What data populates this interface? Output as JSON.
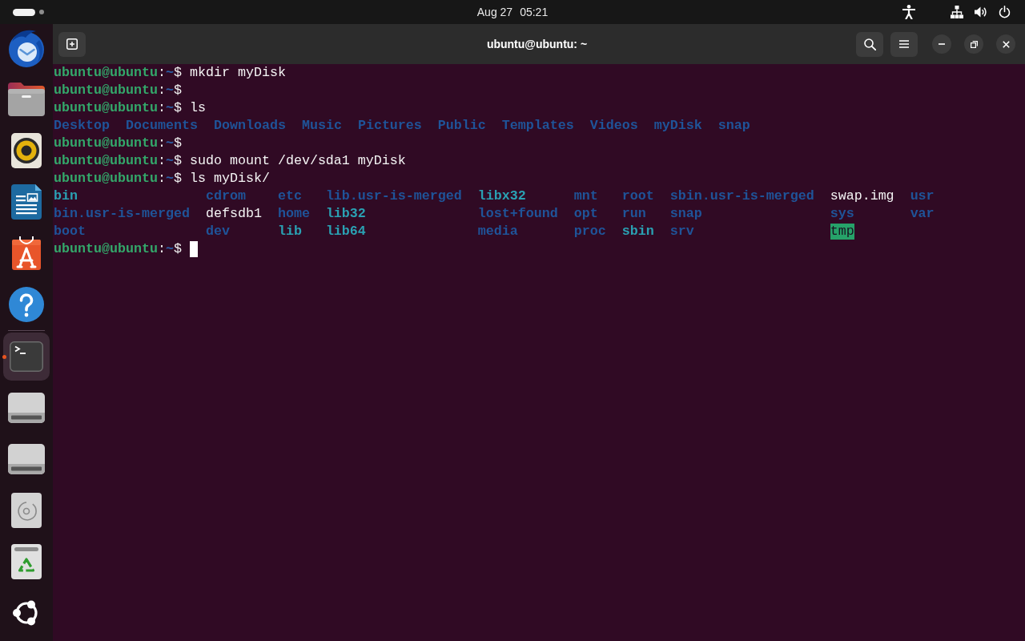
{
  "top_bar": {
    "workspaces": [
      {
        "selected": true
      },
      {
        "selected": false
      }
    ],
    "date": "Aug 27",
    "time": "05:21"
  },
  "dock": {
    "pinned": [
      {
        "kind": "mail",
        "active": false,
        "running": false
      },
      {
        "kind": "folder",
        "active": false,
        "running": false
      },
      {
        "kind": "speaker",
        "active": false,
        "running": false
      },
      {
        "kind": "writer",
        "active": false,
        "running": false
      },
      {
        "kind": "bag",
        "active": false,
        "running": false
      },
      {
        "kind": "help",
        "active": false,
        "running": false
      }
    ],
    "running": [
      {
        "kind": "terminal",
        "active": true,
        "running": true
      }
    ],
    "mounts": [
      {
        "kind": "drive",
        "active": false,
        "running": false
      },
      {
        "kind": "drive",
        "active": false,
        "running": false
      },
      {
        "kind": "disc",
        "active": false,
        "running": false
      },
      {
        "kind": "trash",
        "active": false,
        "running": false
      }
    ]
  },
  "window": {
    "title": "ubuntu@ubuntu: ~"
  },
  "terminal": {
    "lines": [
      {
        "kind": "prompt",
        "user": "ubuntu@ubuntu",
        "separator": ":",
        "path": "~",
        "symbol": "$",
        "command": "mkdir myDisk",
        "cursor": false
      },
      {
        "kind": "prompt",
        "user": "ubuntu@ubuntu",
        "separator": ":",
        "path": "~",
        "symbol": "$",
        "cursor": false
      },
      {
        "kind": "prompt",
        "user": "ubuntu@ubuntu",
        "separator": ":",
        "path": "~",
        "symbol": "$",
        "command": "ls",
        "cursor": false
      },
      {
        "kind": "listing",
        "columns": [
          [
            {
              "name": "Desktop",
              "kind": "dir"
            }
          ],
          [
            {
              "name": "Documents",
              "kind": "dir"
            }
          ],
          [
            {
              "name": "Downloads",
              "kind": "dir"
            }
          ],
          [
            {
              "name": "Music",
              "kind": "dir"
            }
          ],
          [
            {
              "name": "Pictures",
              "kind": "dir"
            }
          ],
          [
            {
              "name": "Public",
              "kind": "dir"
            }
          ],
          [
            {
              "name": "Templates",
              "kind": "dir"
            }
          ],
          [
            {
              "name": "Videos",
              "kind": "dir"
            }
          ],
          [
            {
              "name": "myDisk",
              "kind": "dir"
            }
          ],
          [
            {
              "name": "snap",
              "kind": "dir"
            }
          ]
        ]
      },
      {
        "kind": "prompt",
        "user": "ubuntu@ubuntu",
        "separator": ":",
        "path": "~",
        "symbol": "$",
        "cursor": false
      },
      {
        "kind": "prompt",
        "user": "ubuntu@ubuntu",
        "separator": ":",
        "path": "~",
        "symbol": "$",
        "command": "sudo mount /dev/sda1 myDisk",
        "cursor": false
      },
      {
        "kind": "prompt",
        "user": "ubuntu@ubuntu",
        "separator": ":",
        "path": "~",
        "symbol": "$",
        "command": "ls myDisk/",
        "cursor": false
      },
      {
        "kind": "listing",
        "columns": [
          [
            {
              "name": "bin",
              "kind": "link"
            },
            {
              "name": "bin.usr-is-merged",
              "kind": "dir"
            },
            {
              "name": "boot",
              "kind": "dir"
            }
          ],
          [
            {
              "name": "cdrom",
              "kind": "dir"
            },
            {
              "name": "defsdb1",
              "kind": "file"
            },
            {
              "name": "dev",
              "kind": "dir"
            }
          ],
          [
            {
              "name": "etc",
              "kind": "dir"
            },
            {
              "name": "home",
              "kind": "dir"
            },
            {
              "name": "lib",
              "kind": "link"
            }
          ],
          [
            {
              "name": "lib.usr-is-merged",
              "kind": "dir"
            },
            {
              "name": "lib32",
              "kind": "link"
            },
            {
              "name": "lib64",
              "kind": "link"
            }
          ],
          [
            {
              "name": "libx32",
              "kind": "link"
            },
            {
              "name": "lost+found",
              "kind": "dir"
            },
            {
              "name": "media",
              "kind": "dir"
            }
          ],
          [
            {
              "name": "mnt",
              "kind": "dir"
            },
            {
              "name": "opt",
              "kind": "dir"
            },
            {
              "name": "proc",
              "kind": "dir"
            }
          ],
          [
            {
              "name": "root",
              "kind": "dir"
            },
            {
              "name": "run",
              "kind": "dir"
            },
            {
              "name": "sbin",
              "kind": "link"
            }
          ],
          [
            {
              "name": "sbin.usr-is-merged",
              "kind": "dir"
            },
            {
              "name": "snap",
              "kind": "dir"
            },
            {
              "name": "srv",
              "kind": "dir"
            }
          ],
          [
            {
              "name": "swap.img",
              "kind": "file"
            },
            {
              "name": "sys",
              "kind": "dir"
            },
            {
              "name": "tmp",
              "kind": "sticky"
            }
          ],
          [
            {
              "name": "usr",
              "kind": "dir"
            },
            {
              "name": "var",
              "kind": "dir"
            }
          ]
        ]
      },
      {
        "kind": "prompt",
        "user": "ubuntu@ubuntu",
        "separator": ":",
        "path": "~",
        "symbol": "$",
        "cursor": true
      }
    ]
  }
}
